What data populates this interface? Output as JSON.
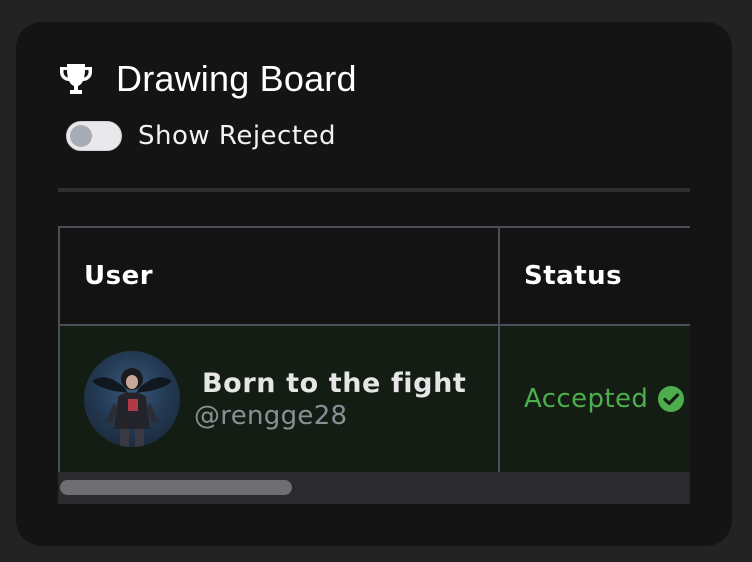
{
  "header": {
    "title": "Drawing Board",
    "icon": "trophy-icon"
  },
  "filters": {
    "show_rejected_label": "Show Rejected",
    "show_rejected_on": false
  },
  "table": {
    "columns": [
      "User",
      "Status"
    ],
    "rows": [
      {
        "display_name": "Born to the fight",
        "handle": "@rengge28",
        "status": "Accepted",
        "status_icon": "check-circle-icon"
      }
    ]
  },
  "colors": {
    "accepted": "#4cae4c",
    "row_background": "#141d14"
  }
}
